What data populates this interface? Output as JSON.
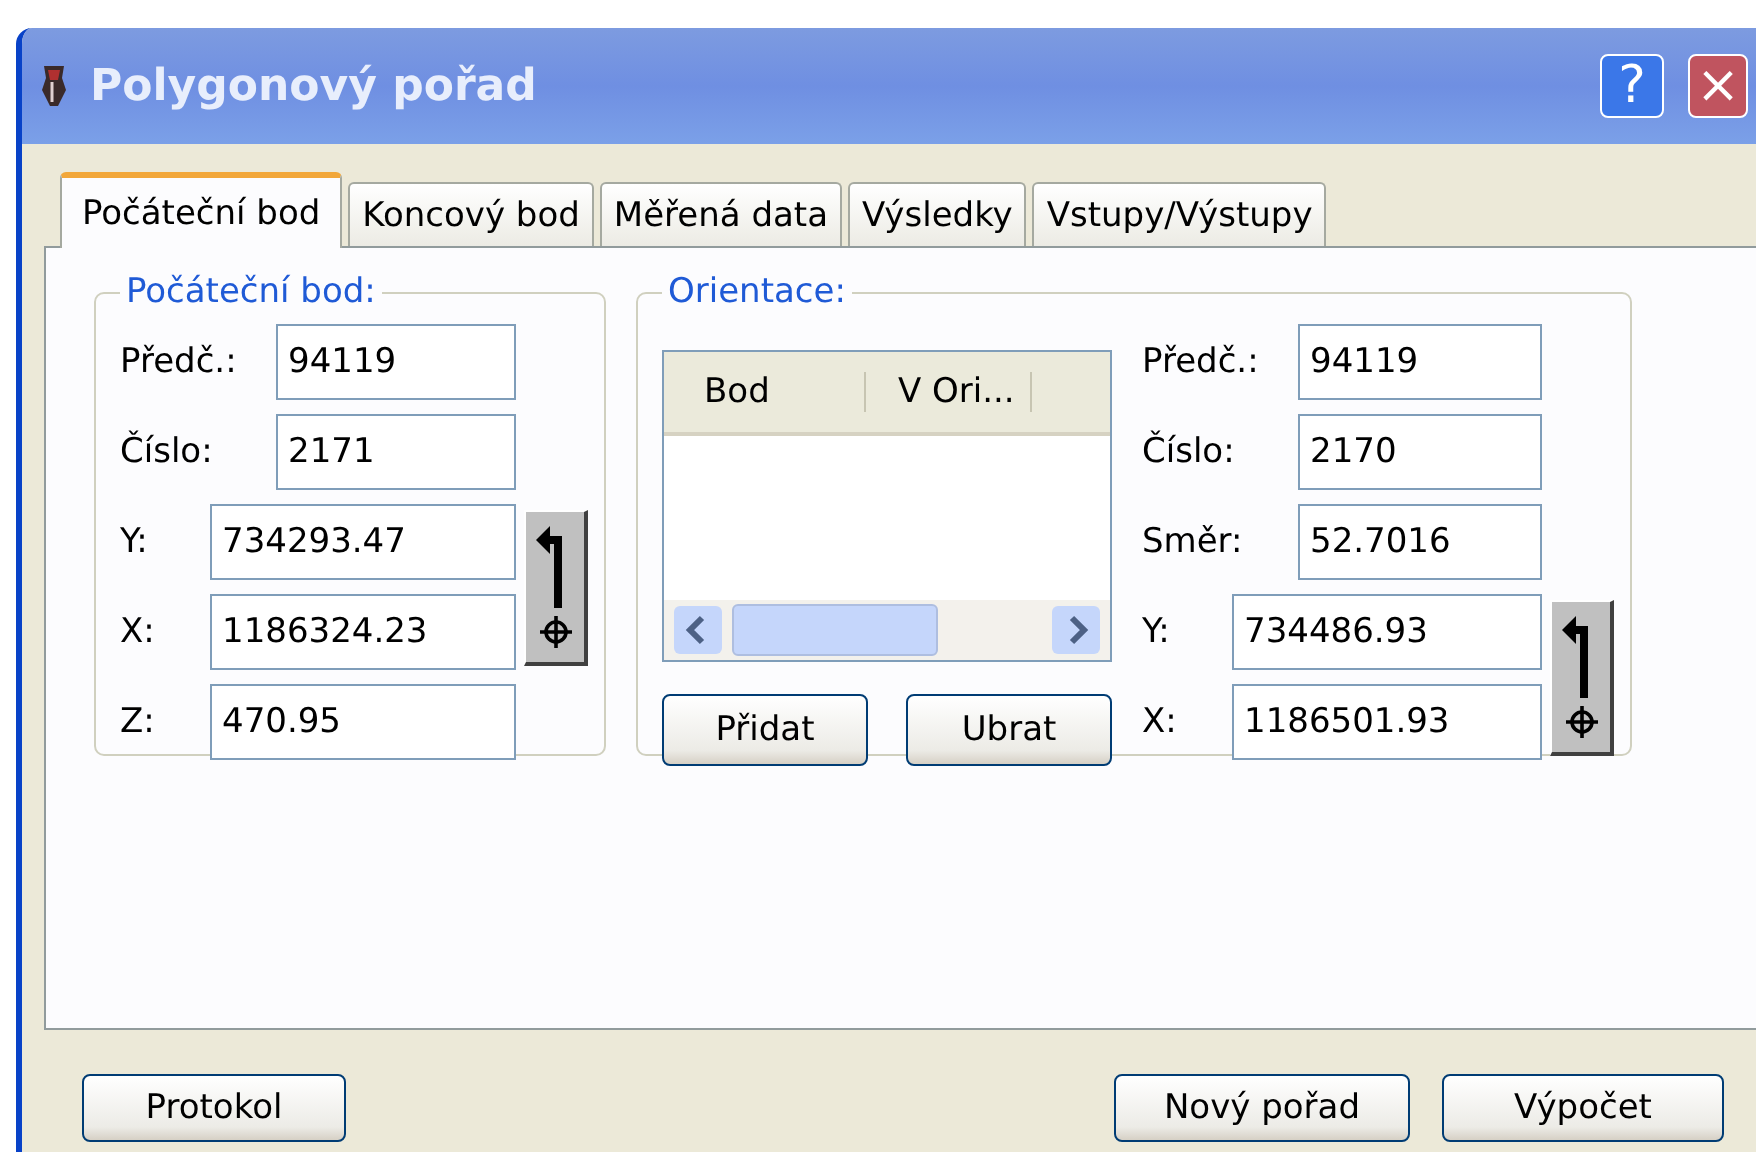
{
  "window": {
    "title": "Polygonový pořad",
    "help_button": "?",
    "close_button": "×"
  },
  "tabs": [
    {
      "label": "Počáteční bod",
      "selected": true
    },
    {
      "label": "Koncový bod",
      "selected": false
    },
    {
      "label": "Měřená data",
      "selected": false
    },
    {
      "label": "Výsledky",
      "selected": false
    },
    {
      "label": "Vstupy/Výstupy",
      "selected": false
    }
  ],
  "start_point": {
    "legend": "Počáteční bod:",
    "fields": [
      {
        "kind": "id",
        "label": "Předč.:",
        "value": "94119"
      },
      {
        "kind": "id",
        "label": "Číslo:",
        "value": "2171"
      },
      {
        "kind": "coord",
        "label": "Y:",
        "value": "734293.47"
      },
      {
        "kind": "coord",
        "label": "X:",
        "value": "1186324.23"
      },
      {
        "kind": "coord",
        "label": "Z:",
        "value": "470.95"
      }
    ]
  },
  "orientation": {
    "legend": "Orientace:",
    "list": {
      "columns": [
        "Bod",
        "V Ori..."
      ]
    },
    "buttons": [
      "Přidat",
      "Ubrat"
    ],
    "fields": [
      {
        "kind": "id",
        "label": "Předč.:",
        "value": "94119"
      },
      {
        "kind": "id",
        "label": "Číslo:",
        "value": "2170"
      },
      {
        "kind": "id",
        "label": "Směr:",
        "value": "52.7016"
      },
      {
        "kind": "coord",
        "label": "Y:",
        "value": "734486.93"
      },
      {
        "kind": "coord",
        "label": "X:",
        "value": "1186501.93"
      }
    ]
  },
  "footer": {
    "left_buttons": [
      "Protokol"
    ],
    "right_buttons": [
      "Nový pořad",
      "Výpočet"
    ]
  }
}
